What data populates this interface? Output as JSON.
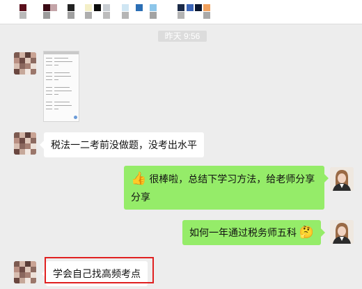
{
  "timestamp": "昨天 9:56",
  "messages": [
    {
      "side": "left",
      "type": "image",
      "content": "document-screenshot"
    },
    {
      "side": "left",
      "type": "text",
      "text": "税法一二考前没做题，没考出水平"
    },
    {
      "side": "right",
      "type": "text",
      "emoji": "👍",
      "text_line1": "很棒啦，总结下学习方法，给老师分享",
      "text_line2": "分享"
    },
    {
      "side": "right",
      "type": "text",
      "text": "如何一年通过税务师五科",
      "emoji": "🤔"
    },
    {
      "side": "left",
      "type": "text",
      "text": "学会自己找高频考点",
      "highlighted": true
    }
  ],
  "colors": {
    "background": "#ededed",
    "bubble_self": "#95ec69",
    "bubble_other": "#ffffff",
    "highlight_border": "#e02020"
  }
}
